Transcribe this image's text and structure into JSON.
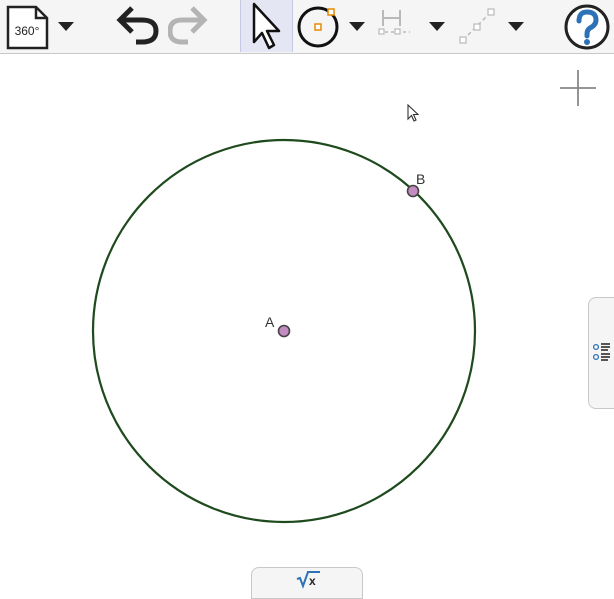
{
  "toolbar": {
    "file_icon_text": "360°",
    "tools": [
      "file-menu",
      "undo",
      "redo",
      "move",
      "circle-center-point",
      "perpendicular-line",
      "segment"
    ]
  },
  "canvas": {
    "points": [
      {
        "label": "A"
      },
      {
        "label": "B"
      }
    ],
    "colors": {
      "circle": "#1e4a1e",
      "point_fill": "#c38cc0",
      "point_stroke": "#444444",
      "help": "#2d72b7",
      "accent_orange": "#e58a00"
    }
  },
  "panels": {
    "side_tab_icon": "algebra-list-icon",
    "bottom_tab_icon": "sqrt-x-icon"
  }
}
